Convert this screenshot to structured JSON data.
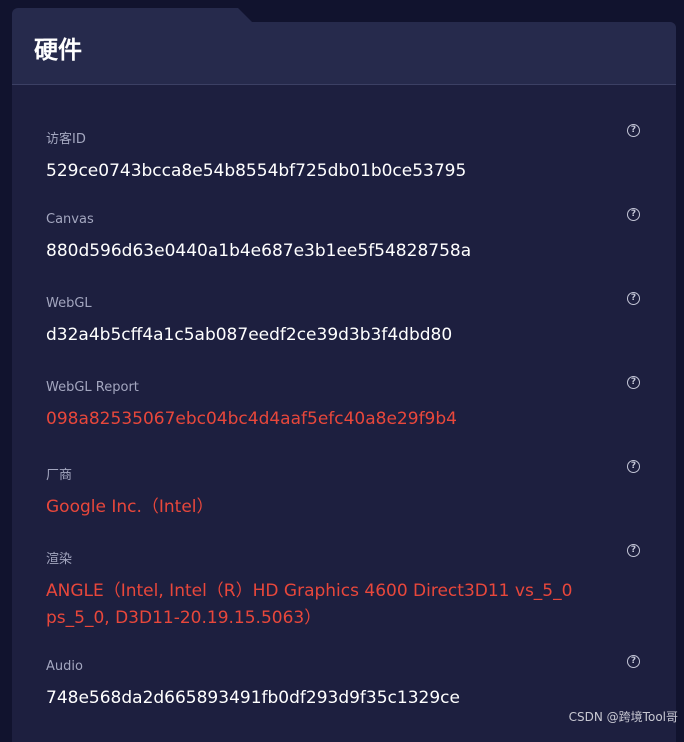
{
  "header": {
    "title": "硬件"
  },
  "fields": [
    {
      "label": "访客ID",
      "value": "529ce0743bcca8e54b8554bf725db01b0ce53795",
      "value_color": "white",
      "help_icon": "question-circle-icon"
    },
    {
      "label": "Canvas",
      "value": "880d596d63e0440a1b4e687e3b1ee5f54828758a",
      "value_color": "white",
      "help_icon": "question-circle-icon"
    },
    {
      "label": "WebGL",
      "value": "d32a4b5cff4a1c5ab087eedf2ce39d3b3f4dbd80",
      "value_color": "white",
      "help_icon": "question-circle-icon"
    },
    {
      "label": "WebGL Report",
      "value": "098a82535067ebc04bc4d4aaf5efc40a8e29f9b4",
      "value_color": "red",
      "help_icon": "question-circle-icon"
    },
    {
      "label": "厂商",
      "value": "Google Inc.（Intel）",
      "value_color": "red",
      "help_icon": "question-circle-icon"
    },
    {
      "label": "渲染",
      "value": "ANGLE（Intel, Intel（R）HD Graphics 4600 Direct3D11 vs_5_0 ps_5_0, D3D11-20.19.15.5063）",
      "value_color": "red",
      "help_icon": "question-circle-icon"
    },
    {
      "label": "Audio",
      "value": "748e568da2d665893491fb0df293d9f35c1329ce",
      "value_color": "white",
      "help_icon": "question-circle-icon"
    }
  ],
  "watermark": "CSDN @跨境Tool哥",
  "colors": {
    "background": "#11132e",
    "panel": "#1d1f3f",
    "header": "#262a4c",
    "label": "#a3a6bf",
    "value_white": "#ffffff",
    "value_red": "#e8473b"
  }
}
